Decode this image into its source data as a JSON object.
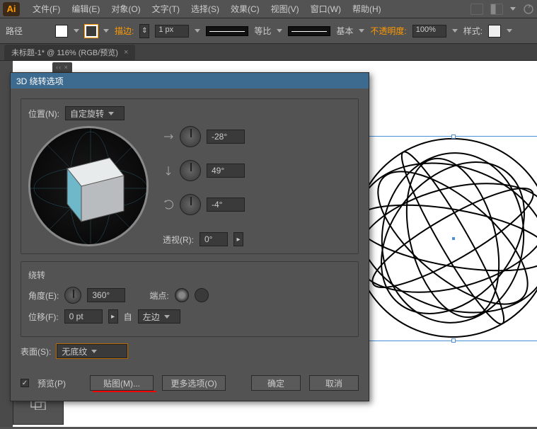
{
  "menubar": {
    "items": [
      "文件(F)",
      "编辑(E)",
      "对象(O)",
      "文字(T)",
      "选择(S)",
      "效果(C)",
      "视图(V)",
      "窗口(W)",
      "帮助(H)"
    ]
  },
  "toolbar": {
    "label": "路径",
    "stroke_label": "描边:",
    "stroke_value": "1 px",
    "profile_label": "等比",
    "brush_label": "基本",
    "opacity_label": "不透明度:",
    "opacity_value": "100%",
    "style_label": "样式:"
  },
  "tab": {
    "title": "未标题-1* @ 116% (RGB/预览)",
    "close": "×"
  },
  "panel_handle": "‹‹ ×",
  "dialog": {
    "title": "3D 绕转选项",
    "position_label": "位置(N):",
    "position_value": "自定旋转",
    "axis_x": "-28°",
    "axis_y": "49°",
    "axis_z": "-4°",
    "persp_label": "透视(R):",
    "persp_value": "0°",
    "revolve_heading": "绕转",
    "angle_label": "角度(E):",
    "angle_value": "360°",
    "cap_label": "端点:",
    "offset_label": "位移(F):",
    "offset_value": "0 pt",
    "from_label": "自",
    "from_value": "左边",
    "surface_label": "表面(S):",
    "surface_value": "无底纹",
    "preview_label": "预览(P)",
    "map_btn": "贴图(M)...",
    "more_btn": "更多选项(O)",
    "ok_btn": "确定",
    "cancel_btn": "取消"
  }
}
